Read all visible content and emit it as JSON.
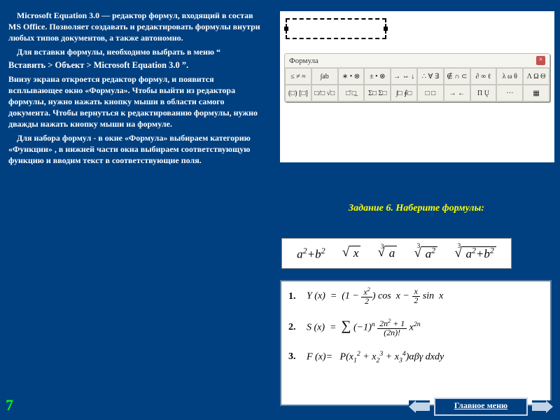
{
  "left": {
    "p1": "Microsoft Equation 3.0 — редактор формул, входящий в состав MS Office.  Позволяет создавать и редактировать формулы внутри любых типов документов, а также автономно.",
    "p2": "Для вставки формулы, необходимо выбрать в меню  “",
    "menu": "Вставить > Объект > Microsoft Equation 3.0  ”.",
    "p3": "Внизу экрана откроется редактор формул, и появится всплывающее окно «Формула». Чтобы выйти из редактора формулы, нужно нажать кнопку мыши в области самого документа. Чтобы вернуться к редактированию формулы, нужно дважды нажать кнопку мыши на формуле.",
    "p4": "Для набора формул  -  в окне «Формула» выбираем категорию «Функции» , в нижней части окна выбираем соответствующую функцию и вводим текст в соответствующие поля."
  },
  "toolbar": {
    "title": "Формула",
    "buttons": [
      "≤ ≠ ≈",
      "∫ab",
      "∗ • ⊗",
      "± • ⊗",
      "→ ⇔ ↓",
      "∴ ∀ ∃",
      "∉ ∩ ⊂",
      "∂ ∞ ℓ",
      "λ ω θ",
      "Λ Ω Θ",
      "(□) [□]",
      "□/□ √□",
      "□̄ □̲",
      "Σ□ Σ□",
      "∫□ ∮□",
      "□ □",
      "→ ←",
      "Π Ų",
      "···",
      "▦"
    ]
  },
  "task": {
    "title": "Задание 6. Наберите формулы:"
  },
  "pageNumber": "7",
  "nav": {
    "menu": "Главное меню"
  }
}
